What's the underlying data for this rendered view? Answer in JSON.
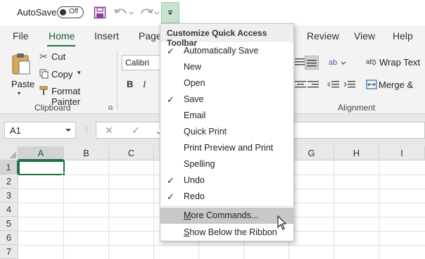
{
  "titlebar": {
    "autosave_label": "AutoSave",
    "autosave_state": "Off",
    "icons": [
      "save-icon",
      "undo-icon",
      "redo-icon",
      "customize-qat-icon"
    ]
  },
  "tabs": [
    {
      "label": "File"
    },
    {
      "label": "Home"
    },
    {
      "label": "Insert"
    },
    {
      "label": "Page"
    },
    {
      "label": "Review"
    },
    {
      "label": "View"
    },
    {
      "label": "Help"
    }
  ],
  "ribbon": {
    "clipboard": {
      "paste": "Paste",
      "cut": "Cut",
      "copy": "Copy",
      "format_painter": "Format Painter",
      "group_label": "Clipboard"
    },
    "font": {
      "font_name": "Calibri",
      "bold": "B",
      "italic": "I"
    },
    "alignment": {
      "wrap_text": "Wrap Text",
      "merge_center": "Merge & Ce",
      "group_label": "Alignment"
    }
  },
  "formula_bar": {
    "name_box": "A1",
    "cancel": "✕",
    "enter": "✓",
    "fx": "J"
  },
  "grid": {
    "columns": [
      "A",
      "B",
      "C",
      "D",
      "E",
      "F",
      "G",
      "H",
      "I"
    ],
    "rows": [
      "1",
      "2",
      "3",
      "4",
      "5",
      "6",
      "7"
    ],
    "active_cell": "A1"
  },
  "menu": {
    "title": "Customize Quick Access Toolbar",
    "items": [
      {
        "label": "Automatically Save",
        "checked": "✓"
      },
      {
        "label": "New",
        "checked": ""
      },
      {
        "label": "Open",
        "checked": ""
      },
      {
        "label": "Save",
        "checked": "✓"
      },
      {
        "label": "Email",
        "checked": ""
      },
      {
        "label": "Quick Print",
        "checked": ""
      },
      {
        "label": "Print Preview and Print",
        "checked": ""
      },
      {
        "label": "Spelling",
        "checked": ""
      },
      {
        "label": "Undo",
        "checked": "✓"
      },
      {
        "label": "Redo",
        "checked": "✓"
      }
    ],
    "more_commands": "More Commands...",
    "show_below": "Show Below the Ribbon"
  },
  "colors": {
    "excel_green": "#1e7145",
    "qat_highlight": "#c6e3cf",
    "save_purple": "#8b3f9e"
  }
}
